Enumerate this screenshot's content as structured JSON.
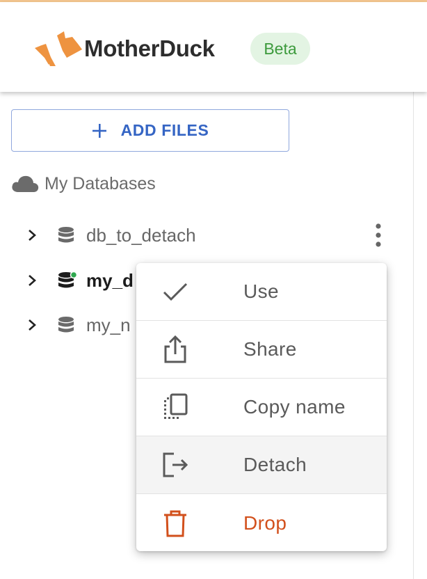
{
  "app": {
    "brand_name": "MotherDuck",
    "badge": "Beta",
    "colors": {
      "accent": "#3565c4",
      "badge_bg": "#e3f4e3",
      "badge_text": "#3c9a3c",
      "logo": "#ee9340",
      "danger": "#d2501c",
      "attached_dot": "#2fa84f"
    }
  },
  "sidebar": {
    "add_files_label": "ADD FILES",
    "section_title": "My Databases",
    "databases": [
      {
        "name": "db_to_detach",
        "active": false
      },
      {
        "name": "my_d",
        "active": true
      },
      {
        "name": "my_n",
        "active": false
      }
    ]
  },
  "context_menu": {
    "items": [
      {
        "label": "Use",
        "icon": "check-icon"
      },
      {
        "label": "Share",
        "icon": "share-icon"
      },
      {
        "label": "Copy name",
        "icon": "copy-icon"
      },
      {
        "label": "Detach",
        "icon": "detach-icon",
        "hovered": true
      },
      {
        "label": "Drop",
        "icon": "trash-icon",
        "danger": true
      }
    ]
  }
}
